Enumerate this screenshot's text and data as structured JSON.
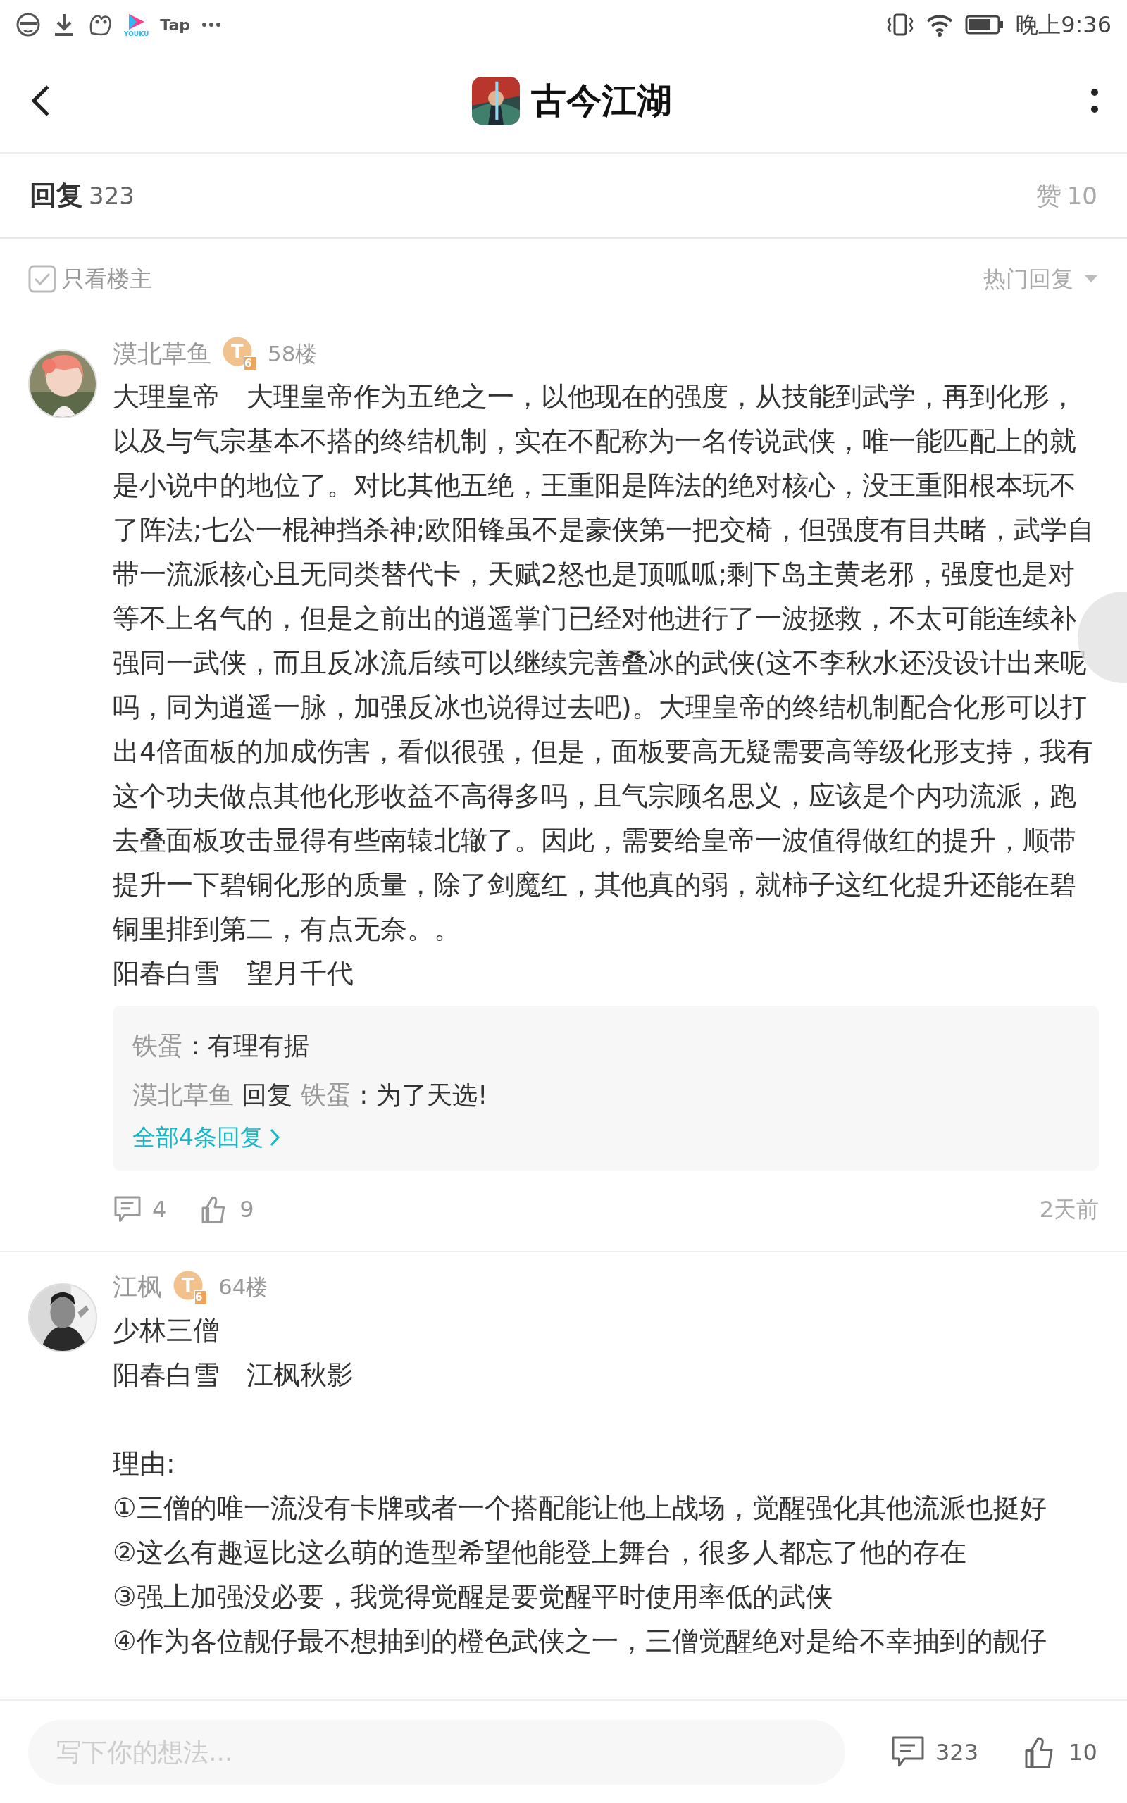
{
  "status_bar": {
    "app_labels": [
      "YOUKU",
      "Tap"
    ],
    "time": "晚上9:36"
  },
  "header": {
    "title": "古今江湖"
  },
  "summary": {
    "replies_label": "回复",
    "replies_count": "323",
    "likes_label": "赞",
    "likes_count": "10"
  },
  "filter": {
    "owner_only": {
      "label": "只看楼主",
      "checked": false
    },
    "sort": "热门回复"
  },
  "comments": [
    {
      "author": "漠北草鱼",
      "badge": {
        "letter": "T",
        "tier": "6"
      },
      "floor": "58楼",
      "blocks": [
        [
          "大理皇帝　大理皇帝作为五绝之一，以他现在的强度，从技能到武学，再到化形，以及与气宗基本不搭的终结机制，实在不配称为一名传说武侠，唯一能匹配上的就是小说中的地位了。对比其他五绝，王重阳是阵法的绝对核心，没王重阳根本玩不了阵法;七公一棍神挡杀神;欧阳锋虽不是豪侠第一把交椅，但强度有目共睹，武学自带一流派核心且无同类替代卡，天赋2怒也是顶呱呱;剩下岛主黄老邪，强度也是对等不上名气的，但是之前出的逍遥掌门已经对他进行了一波拯救，不太可能连续补强同一武侠，而且反冰流后续可以继续完善叠冰的武侠(这不李秋水还没设计出来呢吗，同为逍遥一脉，加强反冰也说得过去吧)。大理皇帝的终结机制配合化形可以打出4倍面板的加成伤害，看似很强，但是，面板要高无疑需要高等级化形支持，我有这个功夫做点其他化形收益不高得多吗，且气宗顾名思义，应该是个内功流派，跑去叠面板攻击显得有些南辕北辙了。因此，需要给皇帝一波值得做红的提升，顺带提升一下碧铜化形的质量，除了剑魔红，其他真的弱，就柿子这红化提升还能在碧铜里排到第二，有点无奈。。",
          "阳春白雪　望月千代"
        ]
      ],
      "replies": {
        "items": [
          {
            "kind": "direct",
            "author": "铁蛋",
            "separator": ":",
            "text": "有理有据"
          },
          {
            "kind": "reply",
            "author": "漠北草鱼",
            "verb": "回复",
            "target": "铁蛋",
            "separator": ":",
            "text": "为了天选!"
          }
        ],
        "more": "全部4条回复"
      },
      "comment_count": "4",
      "like_count": "9",
      "time": "2天前"
    },
    {
      "author": "江枫",
      "badge": {
        "letter": "T",
        "tier": "6"
      },
      "floor": "64楼",
      "blocks": [
        [
          "少林三僧",
          "阳春白雪　江枫秋影"
        ],
        [
          "理由:",
          "①三僧的唯一流没有卡牌或者一个搭配能让他上战场，觉醒强化其他流派也挺好",
          "②这么有趣逗比这么萌的造型希望他能登上舞台，很多人都忘了他的存在",
          "③强上加强没必要，我觉得觉醒是要觉醒平时使用率低的武侠",
          "④作为各位靓仔最不想抽到的橙色武侠之一，三僧觉醒绝对是给不幸抽到的靓仔"
        ]
      ]
    }
  ],
  "bottom_bar": {
    "placeholder": "写下你的想法...",
    "comment_count": "323",
    "like_count": "10"
  }
}
